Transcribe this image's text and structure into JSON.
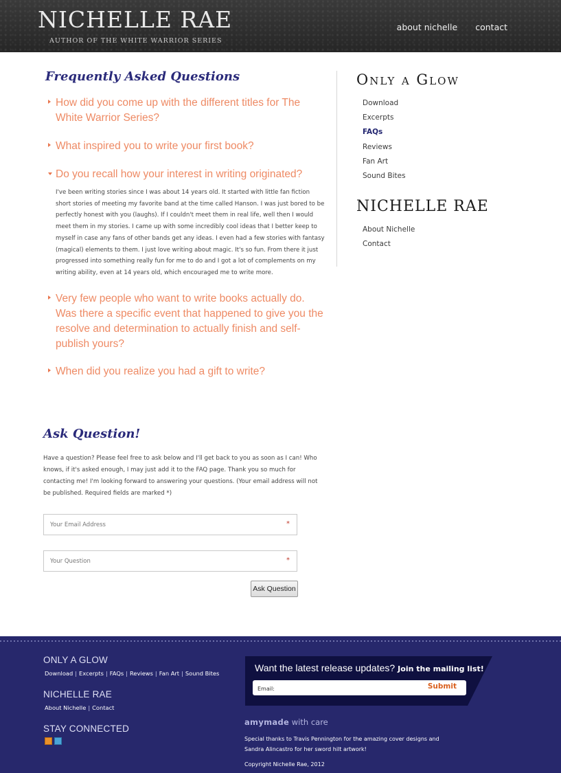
{
  "header": {
    "title": "NICHELLE RAE",
    "tagline": "AUTHOR OF THE WHITE WARRIOR SERIES",
    "nav": [
      "about nichelle",
      "contact"
    ]
  },
  "faq": {
    "heading": "Frequently Asked Questions",
    "items": [
      {
        "question": "How did you come up with the different titles for The White Warrior Series?",
        "expanded": false
      },
      {
        "question": "What inspired you to write your first book?",
        "expanded": false
      },
      {
        "question": "Do you recall how your interest in writing originated?",
        "expanded": true,
        "answer": "I've been writing stories since I was about 14 years old. It started with little fan fiction short stories of meeting my favorite band at the time called Hanson. I was just bored to be perfectly honest with you (laughs). If I couldn't meet them in real life, well then I would meet them in my stories. I came up with some incredibly cool ideas that I better keep to myself in case any fans of other bands get any ideas. I even had a few stories with fantasy (magical) elements to them. I just love writing about magic. It's so fun. From there it just progressed into something really fun for me to do and I got a lot of complements on my writing ability, even at 14 years old, which encouraged me to write more."
      },
      {
        "question": "Very few people who want to write books actually do. Was there a specific event that happened to give you the resolve and determination to actually finish and self-publish yours?",
        "expanded": false
      },
      {
        "question": "When did you realize you had a gift to write?",
        "expanded": false
      }
    ]
  },
  "ask": {
    "heading": "Ask Question!",
    "intro": "Have a question? Please feel free to ask below and I'll get back to you as soon as I can! Who knows, if it's asked enough, I may just add it to the FAQ page. Thank you so much for contacting me! I'm looking forward to answering your questions. (Your email address will not be published. Required fields are marked *)",
    "email_placeholder": "Your Email Address",
    "question_placeholder": "Your Question",
    "required_mark": "*",
    "button": "Ask Question"
  },
  "sidebar": {
    "section1_title": "Only a Glow",
    "section1_items": [
      "Download",
      "Excerpts",
      "FAQs",
      "Reviews",
      "Fan Art",
      "Sound Bites"
    ],
    "active_item": "FAQs",
    "section2_title": "NICHELLE RAE",
    "section2_items": [
      "About Nichelle",
      "Contact"
    ]
  },
  "footer": {
    "col1_title": "ONLY A GLOW",
    "col1_links": [
      "Download",
      "Excerpts",
      "FAQs",
      "Reviews",
      "Fan Art",
      "Sound Bites"
    ],
    "col2_title": "NICHELLE RAE",
    "col2_links": [
      "About Nichelle",
      "Contact"
    ],
    "col3_title": "STAY CONNECTED",
    "social_icons": [
      "rss-icon",
      "twitter-icon"
    ],
    "mailing": {
      "headline": "Want the latest release updates?",
      "subline": "Join the mailing list!",
      "email_placeholder": "Email:",
      "submit": "Submit"
    },
    "credit_brand": "amymade",
    "credit_suffix": "with care",
    "thanks": "Special thanks to Travis Pennington for the amazing cover designs and Sandra Alincastro for her sword hilt artwork!",
    "copyright": "Copyright Nichelle Rae, 2012"
  },
  "colors": {
    "accent_orange": "#ee8a64",
    "heading_blue": "#2a2a7a",
    "footer_bg": "#27286c"
  }
}
